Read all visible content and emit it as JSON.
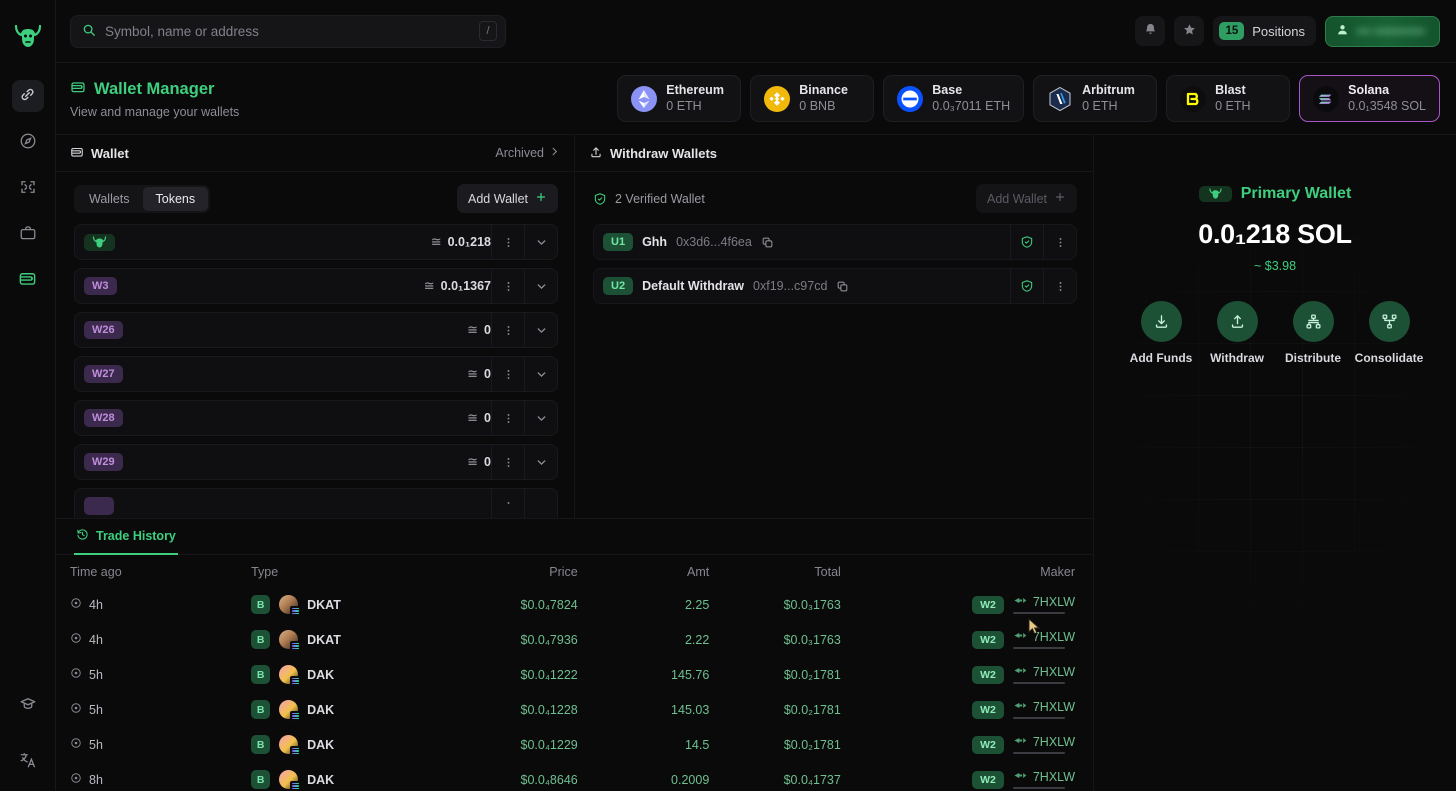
{
  "sidebar": {
    "logo_icon": "bull-logo",
    "items": [
      {
        "icon": "link-icon",
        "name": "link",
        "active": true
      },
      {
        "icon": "compass-icon",
        "name": "explore",
        "active": false
      },
      {
        "icon": "scan-icon",
        "name": "scan",
        "active": false
      },
      {
        "icon": "briefcase-icon",
        "name": "portfolio",
        "active": false
      },
      {
        "icon": "wallet-icon",
        "name": "wallet",
        "active": true
      }
    ],
    "bottom_items": [
      {
        "icon": "graduation-cap-icon",
        "name": "learn"
      },
      {
        "icon": "translate-icon",
        "name": "language"
      }
    ]
  },
  "topbar": {
    "search": {
      "placeholder": "Symbol, name or address",
      "value": "",
      "shortcut": "/"
    },
    "notification_icon": "bell-icon",
    "favorites_icon": "star-icon",
    "positions": {
      "count": "15",
      "label": "Positions"
    },
    "account": {
      "label": "••• •••••••••••",
      "redacted": true
    }
  },
  "wallet_manager": {
    "icon": "wallet-icon",
    "title": "Wallet Manager",
    "subtitle": "View and manage your wallets",
    "chains": [
      {
        "name": "Ethereum",
        "balance": "0 ETH",
        "icon": "ethereum-icon",
        "selected": false
      },
      {
        "name": "Binance",
        "balance": "0 BNB",
        "icon": "binance-icon",
        "selected": false
      },
      {
        "name": "Base",
        "balance": "0.0₃7011 ETH",
        "icon": "base-icon",
        "selected": false
      },
      {
        "name": "Arbitrum",
        "balance": "0 ETH",
        "icon": "arbitrum-icon",
        "selected": false
      },
      {
        "name": "Blast",
        "balance": "0 ETH",
        "icon": "blast-icon",
        "selected": false
      },
      {
        "name": "Solana",
        "balance": "0.0₁3548 SOL",
        "icon": "solana-icon",
        "selected": true
      }
    ]
  },
  "wallet_panel": {
    "header_title": "Wallet",
    "header_icon": "wallet-icon",
    "archived_label": "Archived",
    "tabs": [
      {
        "label": "Wallets",
        "active": false
      },
      {
        "label": "Tokens",
        "active": true
      }
    ],
    "add_wallet_label": "Add Wallet",
    "rows": [
      {
        "tag": "bull",
        "tag_type": "bull",
        "balance": "0.0₁218"
      },
      {
        "tag": "W3",
        "tag_type": "purple",
        "balance": "0.0₁1367"
      },
      {
        "tag": "W26",
        "tag_type": "purple",
        "balance": "0"
      },
      {
        "tag": "W27",
        "tag_type": "purple",
        "balance": "0"
      },
      {
        "tag": "W28",
        "tag_type": "purple",
        "balance": "0"
      },
      {
        "tag": "W29",
        "tag_type": "purple",
        "balance": "0"
      }
    ],
    "approx_symbol": "≅"
  },
  "withdraw_panel": {
    "header_title": "Withdraw Wallets",
    "header_icon": "upload-icon",
    "verified_label": "2 Verified Wallet",
    "add_wallet_label": "Add Wallet",
    "rows": [
      {
        "tag": "U1",
        "name": "Ghh",
        "address": "0x3d6...4f6ea"
      },
      {
        "tag": "U2",
        "name": "Default Withdraw",
        "address": "0xf19...c97cd"
      }
    ]
  },
  "primary_wallet": {
    "badge_icon": "bull-logo",
    "title": "Primary Wallet",
    "amount": "0.0₁218 SOL",
    "usd": "~ $3.98",
    "actions": [
      {
        "label": "Add Funds",
        "icon": "download-icon"
      },
      {
        "label": "Withdraw",
        "icon": "upload-icon"
      },
      {
        "label": "Distribute",
        "icon": "distribute-icon"
      },
      {
        "label": "Consolidate",
        "icon": "consolidate-icon"
      }
    ]
  },
  "trade_history": {
    "tab_label": "Trade History",
    "tab_icon": "history-icon",
    "columns": [
      "Time ago",
      "Type",
      "Price",
      "Amt",
      "Total",
      "Maker"
    ],
    "rows": [
      {
        "time": "4h",
        "side": "B",
        "token": "DKAT",
        "avatar": "dkat-avatar",
        "price": "$0.0₄7824",
        "amt": "2.25",
        "total": "$0.0₃1763",
        "maker_wallet": "W2",
        "maker": "7HXLW"
      },
      {
        "time": "4h",
        "side": "B",
        "token": "DKAT",
        "avatar": "dkat-avatar",
        "price": "$0.0₄7936",
        "amt": "2.22",
        "total": "$0.0₃1763",
        "maker_wallet": "W2",
        "maker": "7HXLW"
      },
      {
        "time": "5h",
        "side": "B",
        "token": "DAK",
        "avatar": "dak-avatar",
        "price": "$0.0₄1222",
        "amt": "145.76",
        "total": "$0.0₂1781",
        "maker_wallet": "W2",
        "maker": "7HXLW"
      },
      {
        "time": "5h",
        "side": "B",
        "token": "DAK",
        "avatar": "dak-avatar",
        "price": "$0.0₄1228",
        "amt": "145.03",
        "total": "$0.0₂1781",
        "maker_wallet": "W2",
        "maker": "7HXLW"
      },
      {
        "time": "5h",
        "side": "B",
        "token": "DAK",
        "avatar": "dak-avatar",
        "price": "$0.0₄1229",
        "amt": "14.5",
        "total": "$0.0₂1781",
        "maker_wallet": "W2",
        "maker": "7HXLW"
      },
      {
        "time": "8h",
        "side": "B",
        "token": "DAK",
        "avatar": "dak-avatar",
        "price": "$0.0₄8646",
        "amt": "0.2009",
        "total": "$0.0₄1737",
        "maker_wallet": "W2",
        "maker": "7HXLW"
      }
    ]
  },
  "colors": {
    "accent_green": "#3ecf7e",
    "purple": "#a855c7",
    "bg": "#0a0a0b",
    "panel": "#0f0f12"
  }
}
